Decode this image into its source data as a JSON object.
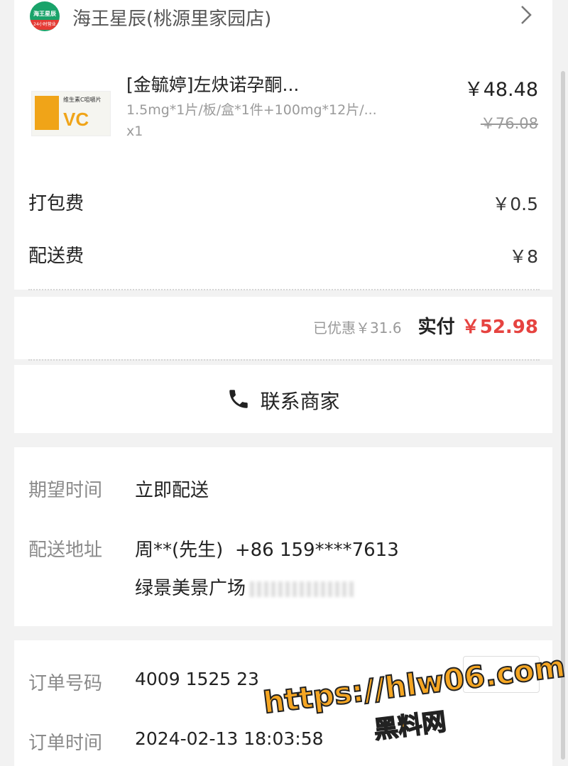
{
  "store": {
    "name": "海王星辰(桃源里家园店)",
    "logo_text": "海王星辰",
    "logo_sub": "24小时营业"
  },
  "product": {
    "name": "[金毓婷]左炔诺孕酮...",
    "spec": "1.5mg*1片/板/盒*1件+100mg*12片/...",
    "qty": "x1",
    "price": "￥48.48",
    "original_price": "￥76.08",
    "image_text": "维生素C咀嚼片",
    "image_vc": "VC"
  },
  "fees": {
    "packing_label": "打包费",
    "packing_value": "￥0.5",
    "delivery_label": "配送费",
    "delivery_value": "￥8"
  },
  "summary": {
    "discount": "已优惠￥31.6",
    "paid_label": "实付",
    "paid_value": "￥52.98"
  },
  "contact": {
    "label": "联系商家"
  },
  "delivery": {
    "time_label": "期望时间",
    "time_value": "立即配送",
    "address_label": "配送地址",
    "address_name": "周**(先生)  +86 159****7613",
    "address_detail": "绿景美景广场"
  },
  "order": {
    "number_label": "订单号码",
    "number_value": "4009 1525 23",
    "time_label": "订单时间",
    "time_value": "2024-02-13 18:03:58"
  },
  "watermark": {
    "url": "https://hlw06.com",
    "name": "黑料网"
  }
}
